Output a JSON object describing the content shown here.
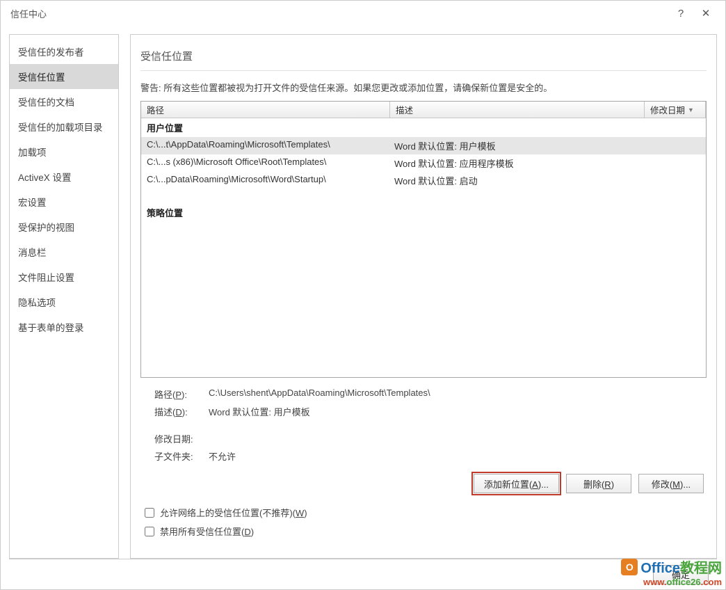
{
  "title": "信任中心",
  "help_icon": "?",
  "close_icon": "✕",
  "sidebar": {
    "items": [
      {
        "label": "受信任的发布者"
      },
      {
        "label": "受信任位置"
      },
      {
        "label": "受信任的文档"
      },
      {
        "label": "受信任的加载项目录"
      },
      {
        "label": "加载项"
      },
      {
        "label": "ActiveX 设置"
      },
      {
        "label": "宏设置"
      },
      {
        "label": "受保护的视图"
      },
      {
        "label": "消息栏"
      },
      {
        "label": "文件阻止设置"
      },
      {
        "label": "隐私选项"
      },
      {
        "label": "基于表单的登录"
      }
    ],
    "selected_index": 1
  },
  "main": {
    "section_title": "受信任位置",
    "warning": "警告: 所有这些位置都被视为打开文件的受信任来源。如果您更改或添加位置，请确保新位置是安全的。",
    "columns": {
      "path": "路径",
      "desc": "描述",
      "date": "修改日期"
    },
    "groups": [
      {
        "name": "用户位置",
        "rows": [
          {
            "path": "C:\\...t\\AppData\\Roaming\\Microsoft\\Templates\\",
            "desc": "Word 默认位置: 用户模板",
            "selected": true
          },
          {
            "path": "C:\\...s (x86)\\Microsoft Office\\Root\\Templates\\",
            "desc": "Word 默认位置: 应用程序模板"
          },
          {
            "path": "C:\\...pData\\Roaming\\Microsoft\\Word\\Startup\\",
            "desc": "Word 默认位置: 启动"
          }
        ]
      },
      {
        "name": "策略位置",
        "rows": []
      }
    ],
    "details": {
      "path_label": "路径(P):",
      "path_value": "C:\\Users\\shent\\AppData\\Roaming\\Microsoft\\Templates\\",
      "desc_label": "描述(D):",
      "desc_value": "Word 默认位置: 用户模板",
      "date_label": "修改日期:",
      "date_value": "",
      "sub_label": "子文件夹:",
      "sub_value": "不允许"
    },
    "buttons": {
      "add": "添加新位置(A)...",
      "remove": "删除(R)",
      "modify": "修改(M)..."
    },
    "checks": {
      "allow_network": "允许网络上的受信任位置(不推荐)(W)",
      "disable_all": "禁用所有受信任位置(D)"
    }
  },
  "footer": {
    "ok": "确定"
  },
  "watermark": {
    "brand1": "Office",
    "brand2": "教程网",
    "url_prefix": "www.",
    "url_mid": "office26",
    "url_suffix": ".com"
  }
}
